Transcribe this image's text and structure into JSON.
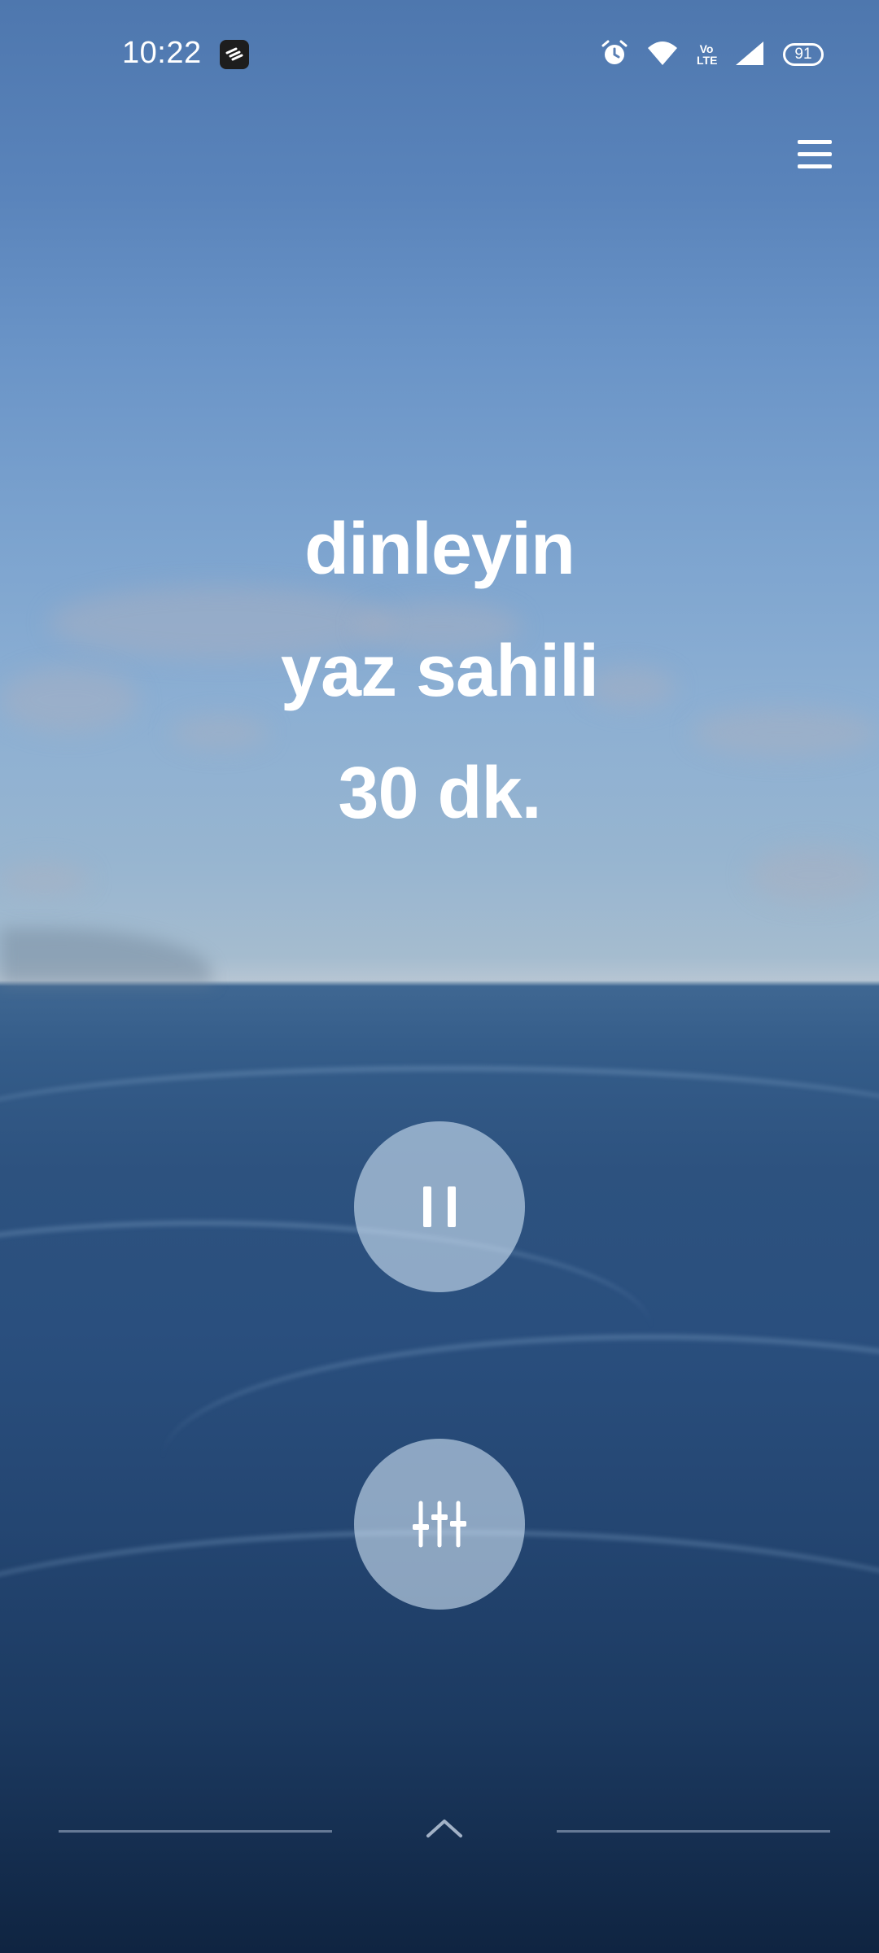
{
  "status_bar": {
    "time": "10:22",
    "icons": [
      "notification-app-icon",
      "alarm-icon",
      "wifi-icon",
      "volte-icon",
      "signal-icon",
      "battery-icon"
    ],
    "volte_label": "Vo LTE",
    "battery_level": "91"
  },
  "header": {
    "menu_icon": "hamburger-menu-icon"
  },
  "player": {
    "action": "dinleyin",
    "track_name": "yaz sahili",
    "duration": "30 dk."
  },
  "controls": {
    "pause_icon": "pause-icon",
    "mixer_icon": "sliders-icon",
    "expand_icon": "chevron-up-icon"
  },
  "colors": {
    "text": "#ffffff",
    "button_fill": "rgba(205,225,242,0.62)",
    "sky_top": "#4e77ae",
    "sea_bottom": "#0f2441"
  }
}
